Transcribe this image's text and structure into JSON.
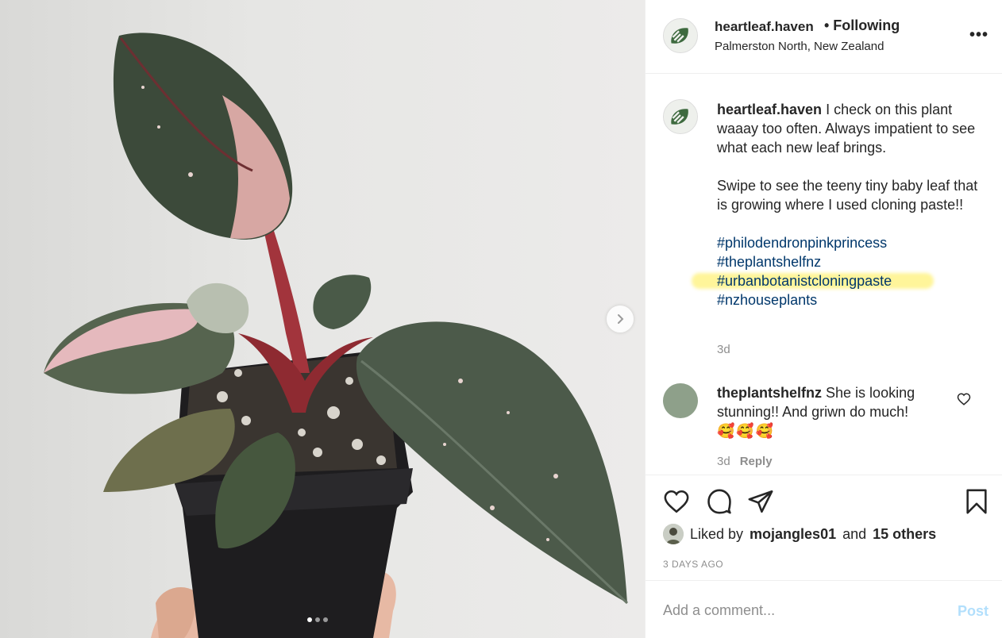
{
  "post": {
    "username": "heartleaf.haven",
    "follow_status": "• Following",
    "location": "Palmerston North, New Zealand",
    "more_icon": "ellipsis-icon",
    "carousel": {
      "next_icon": "chevron-right-icon",
      "slide_count": 3,
      "active_index": 0
    }
  },
  "caption": {
    "username": "heartleaf.haven",
    "text_1": "I check on this plant waaay too often. Always impatient to see what each new leaf brings.",
    "text_2": "Swipe to see the teeny tiny baby leaf that is growing where I used cloning paste!!",
    "hashtags": [
      "#philodendronpinkprincess",
      "#theplantshelfnz",
      "#urbanbotanistcloningpaste",
      "#nzhouseplants"
    ],
    "time": "3d"
  },
  "comment": {
    "username": "theplantshelfnz",
    "text": "She is looking stunning!! And griwn do much!",
    "emojis": "🥰🥰🥰",
    "time": "3d",
    "reply_label": "Reply"
  },
  "actions": {
    "liked_prefix": "Liked by",
    "liked_user": "mojangles01",
    "liked_and": "and",
    "liked_others": "15 others",
    "posted_ago": "3 DAYS AGO"
  },
  "add_comment": {
    "placeholder": "Add a comment...",
    "post_label": "Post"
  },
  "colors": {
    "hashtag": "#00376b",
    "post_button_disabled": "#b2dffc",
    "highlight": "#fff59a",
    "muted_text": "#8e8e8e"
  }
}
